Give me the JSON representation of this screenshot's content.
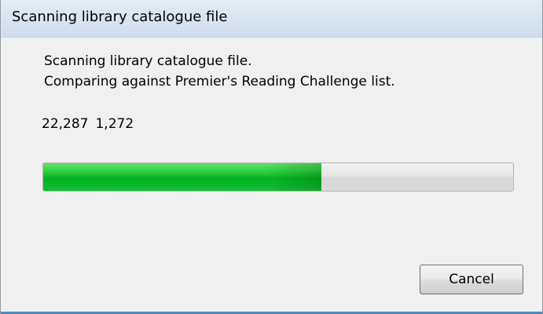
{
  "window": {
    "title": "Scanning library catalogue file"
  },
  "message": {
    "line1": "Scanning library catalogue file.",
    "line2": "Comparing against Premier's Reading Challenge list."
  },
  "counts": {
    "scanned": "22,287",
    "matched": "1,272"
  },
  "progress": {
    "fraction": 0.592,
    "color": "#06b025"
  },
  "buttons": {
    "cancel_label": "Cancel"
  }
}
